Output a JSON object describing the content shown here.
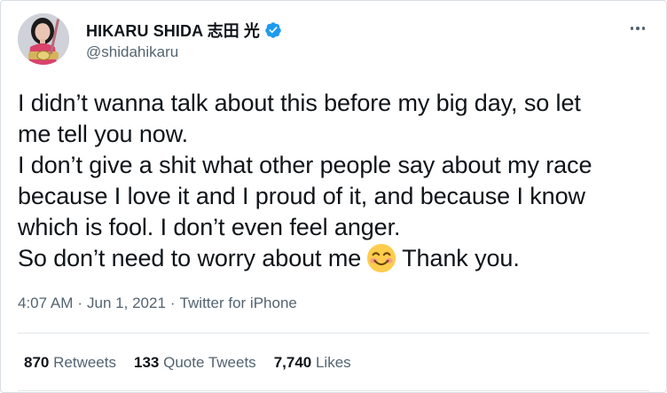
{
  "author": {
    "display_name": "HIKARU SHIDA 志田 光",
    "handle": "@shidahikaru",
    "verified": true,
    "avatar_icon": "profile-photo"
  },
  "more_icon": "more-options-icon",
  "tweet": {
    "lines": [
      "I didn’t wanna talk about this before my big day, so let",
      "me tell you now.",
      "I don’t give a shit what other people say about my race",
      "because I love it and I proud of it, and because I know",
      "which is fool. I don’t even feel anger.",
      "So don’t need to worry about me",
      "Thank you."
    ],
    "emoji": "smiling-face-with-smiling-eyes"
  },
  "meta": {
    "time": "4:07 AM",
    "sep1": "·",
    "date": "Jun 1, 2021",
    "sep2": "·",
    "source": "Twitter for iPhone"
  },
  "stats": {
    "retweets_count": "870",
    "retweets_label": "Retweets",
    "quotes_count": "133",
    "quotes_label": "Quote Tweets",
    "likes_count": "7,740",
    "likes_label": "Likes"
  },
  "colors": {
    "text": "#0f1419",
    "secondary": "#536471",
    "verified": "#1d9bf0",
    "border": "#d8dee3"
  }
}
